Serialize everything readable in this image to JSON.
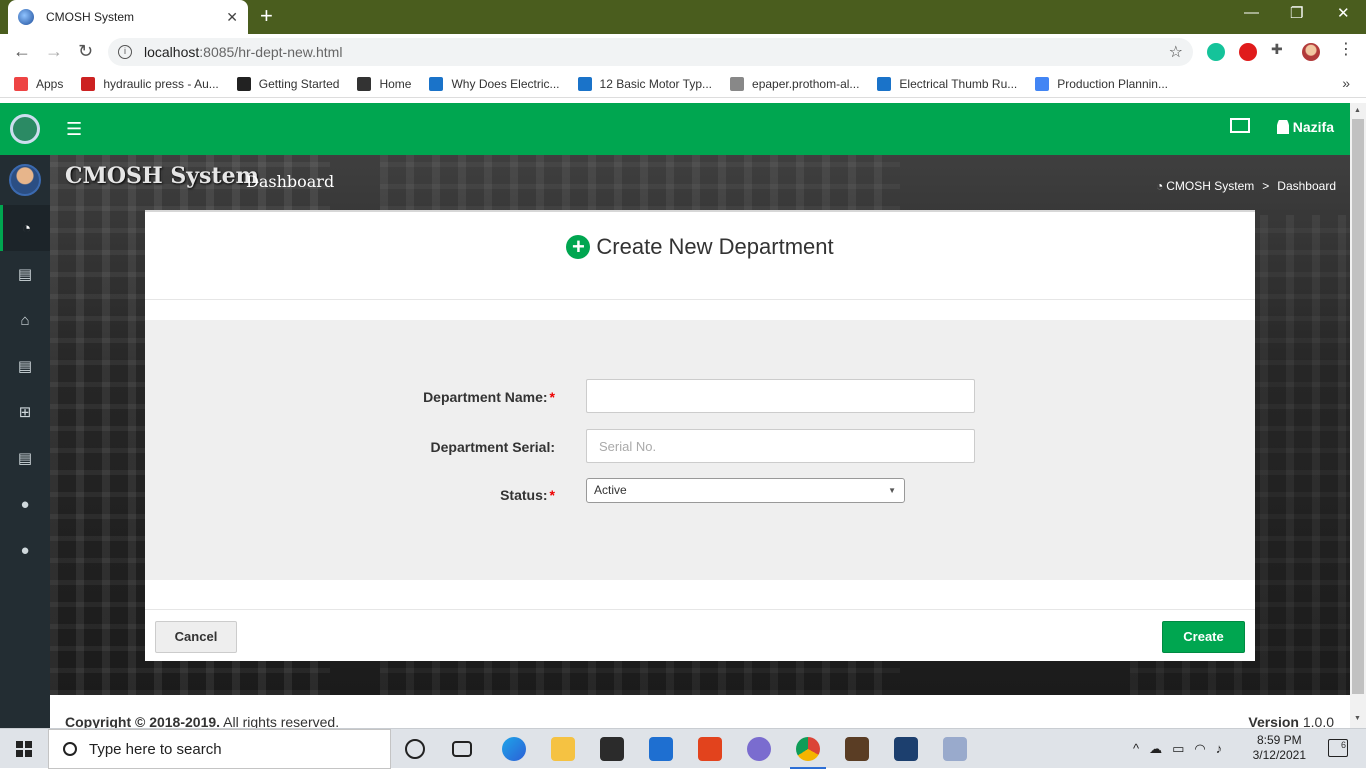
{
  "browser": {
    "tab_title": "CMOSH System",
    "url_host": "localhost",
    "url_path": ":8085/hr-dept-new.html",
    "bookmarks": [
      {
        "label": "Apps",
        "icon": "apps-grid-icon",
        "color": "#e44"
      },
      {
        "label": "hydraulic press - Au...",
        "icon": "gc-icon",
        "color": "#c22"
      },
      {
        "label": "Getting Started",
        "icon": "getting-started-icon",
        "color": "#222"
      },
      {
        "label": "Home",
        "icon": "globe-icon",
        "color": "#333"
      },
      {
        "label": "Why Does Electric...",
        "icon": "doc-icon",
        "color": "#1a73c9"
      },
      {
        "label": "12 Basic Motor Typ...",
        "icon": "doc-icon",
        "color": "#1a73c9"
      },
      {
        "label": "epaper.prothom-al...",
        "icon": "shell-icon",
        "color": "#888"
      },
      {
        "label": "Electrical Thumb Ru...",
        "icon": "doc-icon",
        "color": "#1a73c9"
      },
      {
        "label": "Production Plannin...",
        "icon": "google-icon",
        "color": "#4285f4"
      }
    ],
    "bookmark_overflow": "»"
  },
  "app": {
    "brand_color": "#00a650",
    "user_name": "Nazifa",
    "page_title": "CMOSH System",
    "page_subtitle": "Dashboard",
    "breadcrumb": {
      "home": "CMOSH System",
      "separator": ">",
      "current": "Dashboard"
    },
    "sidebar_icons": [
      "dashboard-icon",
      "id-card-icon",
      "basket-icon",
      "id-card-icon",
      "medkit-icon",
      "id-card-icon",
      "user-icon",
      "user-icon"
    ]
  },
  "form": {
    "title": "Create New Department",
    "fields": {
      "name_label": "Department Name:",
      "name_value": "",
      "serial_label": "Department Serial:",
      "serial_placeholder": "Serial No.",
      "status_label": "Status:",
      "status_value": "Active",
      "required_mark": "*"
    },
    "cancel_label": "Cancel",
    "create_label": "Create"
  },
  "footer": {
    "copyright_bold": "Copyright © 2018-2019.",
    "copyright_rest": " All rights reserved.",
    "version_label": "Version",
    "version_value": " 1.0.0"
  },
  "taskbar": {
    "search_placeholder": "Type here to search",
    "time": "8:59 PM",
    "date": "3/12/2021",
    "notifications": "6"
  }
}
